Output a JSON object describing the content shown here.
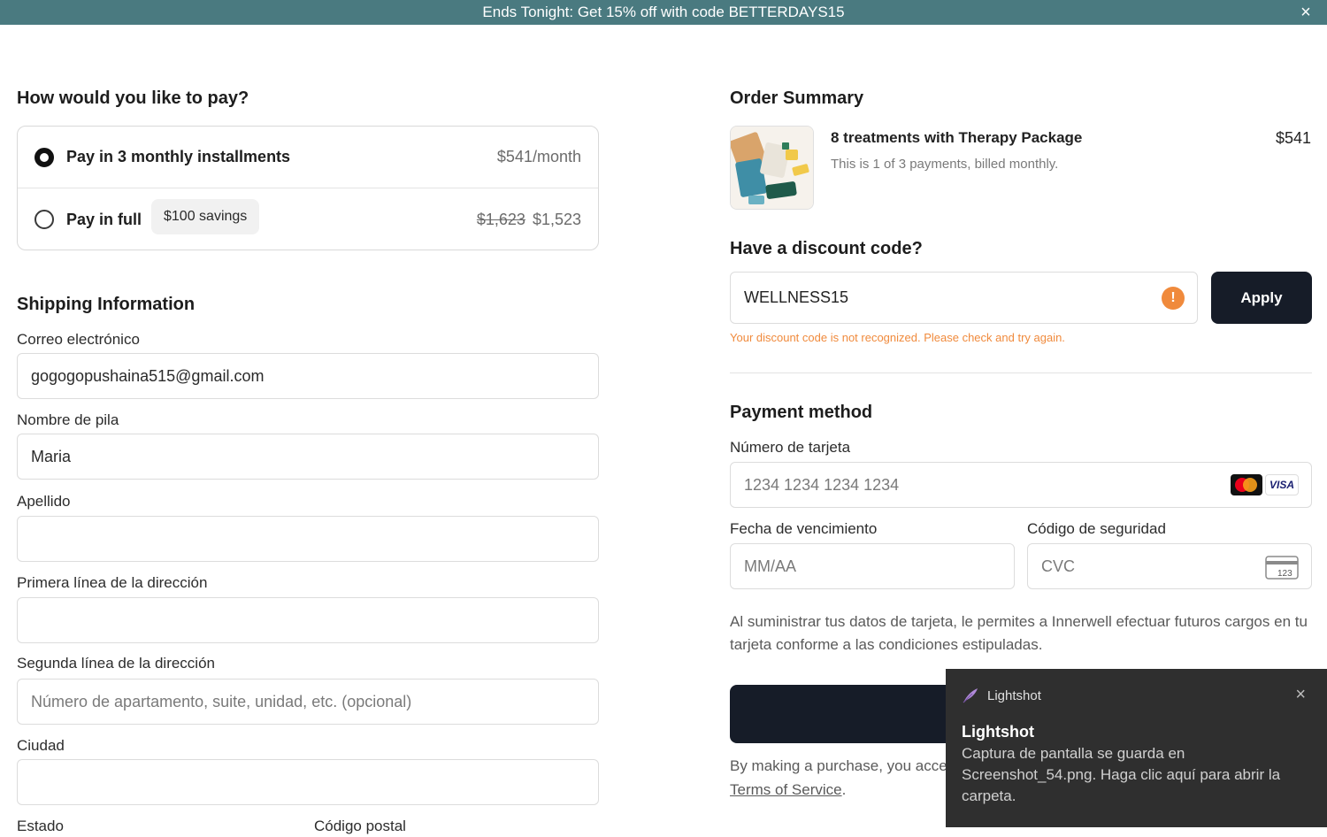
{
  "banner": {
    "text": "Ends Tonight: Get 15% off with code BETTERDAYS15",
    "close_icon": "close-icon"
  },
  "payment_options": {
    "heading": "How would you like to pay?",
    "installments": {
      "label": "Pay in 3 monthly installments",
      "price": "$541/month",
      "selected": true
    },
    "full": {
      "label": "Pay in full",
      "badge": "$100 savings",
      "old_price": "$1,623",
      "price": "$1,523",
      "selected": false
    }
  },
  "shipping": {
    "heading": "Shipping Information",
    "email": {
      "label": "Correo electrónico",
      "value": "gogogopushaina515@gmail.com"
    },
    "first_name": {
      "label": "Nombre de pila",
      "value": "Maria"
    },
    "last_name": {
      "label": "Apellido",
      "value": ""
    },
    "address1": {
      "label": "Primera línea de la dirección",
      "value": ""
    },
    "address2": {
      "label": "Segunda línea de la dirección",
      "placeholder": "Número de apartamento, suite, unidad, etc. (opcional)"
    },
    "city": {
      "label": "Ciudad",
      "value": ""
    },
    "state": {
      "label": "Estado"
    },
    "zip": {
      "label": "Código postal"
    }
  },
  "order_summary": {
    "heading": "Order Summary",
    "product_title": "8 treatments with Therapy Package",
    "product_sub": "This is 1 of 3 payments, billed monthly.",
    "price": "$541"
  },
  "discount": {
    "heading": "Have a discount code?",
    "value": "WELLNESS15",
    "warn_glyph": "!",
    "apply_label": "Apply",
    "error": "Your discount code is not recognized. Please check and try again."
  },
  "payment_method": {
    "heading": "Payment method",
    "card_number": {
      "label": "Número de tarjeta",
      "placeholder": "1234 1234 1234 1234"
    },
    "expiry": {
      "label": "Fecha de vencimiento",
      "placeholder": "MM/AA"
    },
    "cvc": {
      "label": "Código de seguridad",
      "placeholder": "CVC",
      "icon_text": "123"
    },
    "card_brands": [
      "mastercard-icon",
      "visa-icon"
    ],
    "visa_text": "VISA",
    "disclaimer": "Al suministrar tus datos de tarjeta, le permites a Innerwell efectuar futuros cargos en tu tarjeta conforme a las condiciones estipuladas."
  },
  "legal": {
    "prefix": "By making a purchase, you acce",
    "link": "Terms of Service",
    "suffix": "."
  },
  "toast": {
    "app_name": "Lightshot",
    "title": "Lightshot",
    "body": "Captura de pantalla se guarda en Screenshot_54.png. Haga clic aquí para abrir la carpeta."
  },
  "colors": {
    "banner": "#4a7a80",
    "primary_button": "#161c28",
    "warning": "#f08a3c",
    "toast_bg": "#2f2f2f"
  }
}
